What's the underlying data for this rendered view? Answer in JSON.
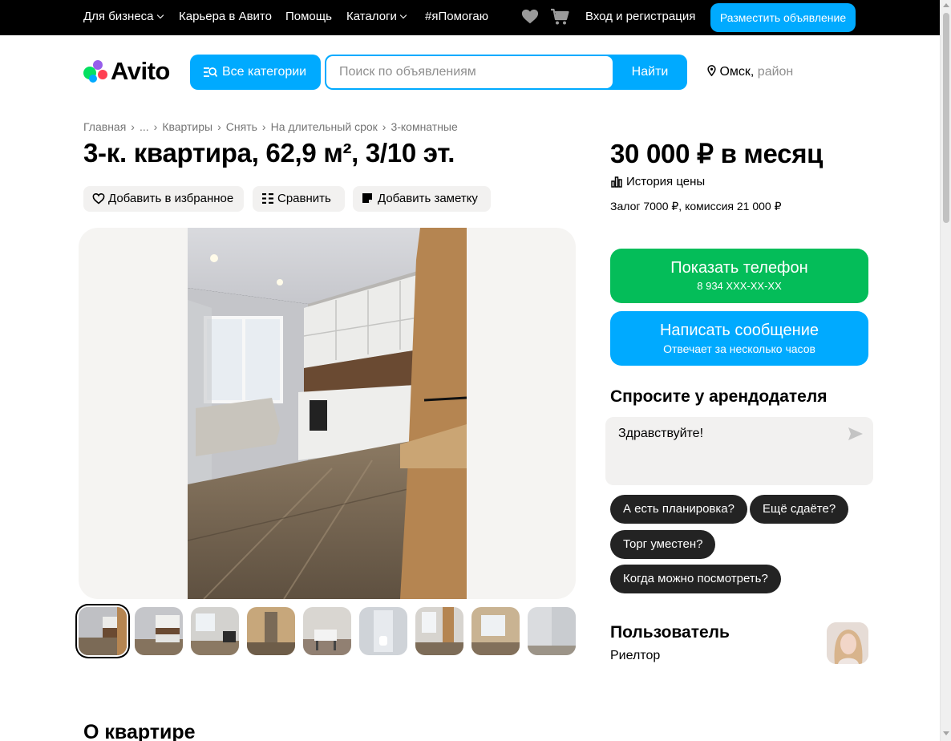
{
  "topbar": {
    "business": "Для бизнеса",
    "career": "Карьера в Авито",
    "help": "Помощь",
    "catalogs": "Каталоги",
    "ihelp": "#яПомогаю",
    "login": "Вход и регистрация",
    "post_ad": "Разместить объявление"
  },
  "header": {
    "logo_text": "Avito",
    "categories_button": "Все категории",
    "search_placeholder": "Поиск по объявлениям",
    "search_button": "Найти",
    "city": "Омск,",
    "district": "район"
  },
  "breadcrumbs": [
    "Главная",
    "...",
    "Квартиры",
    "Снять",
    "На длительный срок",
    "3-комнатные"
  ],
  "listing": {
    "title": "3-к. квартира, 62,9 м², 3/10 эт.",
    "actions": {
      "favorite": "Добавить в избранное",
      "compare": "Сравнить",
      "note": "Добавить заметку"
    },
    "photo_count": 9,
    "active_photo": 1
  },
  "pricing": {
    "price": "30 000 ₽ в месяц",
    "history": "История цены",
    "deposit": "Залог 7000 ₽, комиссия 21 000 ₽"
  },
  "contact": {
    "phone_button": "Показать телефон",
    "phone_masked": "8 934 XXX-XX-XX",
    "message_button": "Написать сообщение",
    "message_sub": "Отвечает за несколько часов"
  },
  "ask": {
    "title": "Спросите у арендодателя",
    "message": "Здравствуйте!",
    "chips": [
      "А есть планировка?",
      "Ещё сдаёте?",
      "Торг уместен?",
      "Когда можно посмотреть?"
    ]
  },
  "seller": {
    "name": "Пользователь",
    "role": "Риелтор"
  },
  "section": {
    "about": "О квартире"
  },
  "colors": {
    "accent_blue": "#00aaff",
    "phone_green": "#04bd59",
    "chip_dark": "#232323",
    "topbar_bg": "#000000"
  },
  "icons": [
    "heart-icon",
    "cart-icon",
    "search-catalog-icon",
    "location-pin-icon",
    "compare-icon",
    "note-icon",
    "chart-icon",
    "send-icon"
  ]
}
